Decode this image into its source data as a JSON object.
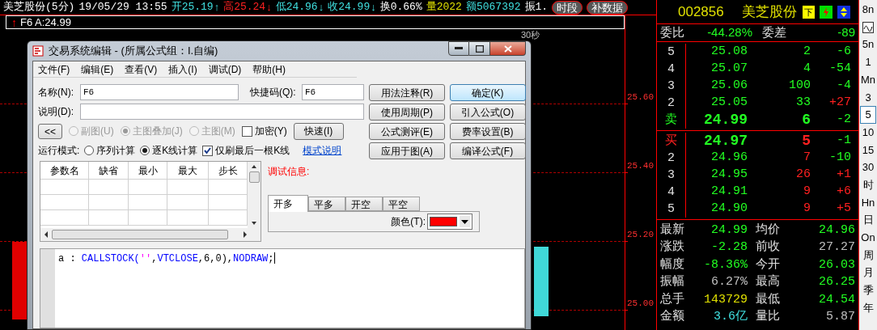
{
  "quote_bar": {
    "items": [
      {
        "text": "美芝股份(5分)",
        "color": "#ffffff"
      },
      {
        "text": "19/05/29 13:55",
        "color": "#ffffff"
      },
      {
        "text": "开25.19",
        "color": "#40e0e0",
        "arrow": "↑"
      },
      {
        "text": "高25.24",
        "color": "#ff2020",
        "arrow": "↓"
      },
      {
        "text": "低24.96",
        "color": "#40e0e0",
        "arrow": "↓"
      },
      {
        "text": "收24.99",
        "color": "#40e0e0",
        "arrow": "↓"
      },
      {
        "text": "换0.66%",
        "color": "#ffffff"
      },
      {
        "text": "量2022",
        "color": "#e0e000"
      },
      {
        "text": "额5067392",
        "color": "#40e0e0"
      },
      {
        "text": "振1.",
        "color": "#ffffff"
      }
    ],
    "badges": [
      "时段",
      "补数据"
    ]
  },
  "formula_line": {
    "arrow": "↑",
    "text": "F6 A:24.99"
  },
  "chart": {
    "time_label": "30秒",
    "price_labels": [
      "25.60",
      "25.40",
      "25.20",
      "25.00"
    ]
  },
  "dialog": {
    "title": "交易系统编辑 - (所属公式组：I.自编)",
    "menu": [
      "文件(F)",
      "编辑(E)",
      "查看(V)",
      "插入(I)",
      "调试(D)",
      "帮助(H)"
    ],
    "name_field": {
      "label": "名称(N):",
      "value": "F6"
    },
    "hotkey_field": {
      "label": "快捷码(Q):",
      "value": "F6"
    },
    "description_field": {
      "label": "说明(D):"
    },
    "buttons": [
      {
        "label": "用法注释(R)",
        "default": false
      },
      {
        "label": "确定(K)",
        "default": true
      },
      {
        "label": "使用周期(P)",
        "default": false
      },
      {
        "label": "引入公式(O)",
        "default": false
      },
      {
        "label": "公式测评(E)",
        "default": false
      },
      {
        "label": "费率设置(B)",
        "default": false
      },
      {
        "label": "应用于图(A)",
        "default": false
      },
      {
        "label": "编译公式(F)",
        "default": false
      }
    ],
    "collapse_button": "<<",
    "chart_options": [
      {
        "label": "副图(U)",
        "selected": false,
        "disabled": true
      },
      {
        "label": "主图叠加(J)",
        "selected": true,
        "disabled": true
      },
      {
        "label": "主图(M)",
        "selected": false,
        "disabled": true
      }
    ],
    "encrypt": {
      "label": "加密(Y)",
      "checked": false
    },
    "fast_button": "快速(I)",
    "run_mode": {
      "label": "运行模式:",
      "options": [
        {
          "label": "序列计算",
          "selected": false
        },
        {
          "label": "逐K线计算",
          "selected": true
        }
      ],
      "last_bar_only": {
        "label": "仅刷最后一根K线",
        "checked": true
      },
      "help_link": "模式说明"
    },
    "param_columns": [
      "参数名",
      "缺省",
      "最小",
      "最大",
      "步长"
    ],
    "debug_label": "调试信息:",
    "signal_tabs": [
      {
        "label": "开多",
        "selected": true
      },
      {
        "label": "平多",
        "selected": false
      },
      {
        "label": "开空",
        "selected": false
      },
      {
        "label": "平空",
        "selected": false
      }
    ],
    "color_picker": {
      "label": "颜色(T):",
      "color": "#ff0000"
    },
    "code": [
      {
        "text": "a : ",
        "kind": "plain"
      },
      {
        "text": "CALLSTOCK(",
        "kind": "keyword"
      },
      {
        "text": "''",
        "kind": "string"
      },
      {
        "text": ",",
        "kind": "plain"
      },
      {
        "text": "VTCLOSE",
        "kind": "keyword"
      },
      {
        "text": ",6,0),",
        "kind": "plain"
      },
      {
        "text": "NODRAW",
        "kind": "keyword"
      },
      {
        "text": ";",
        "kind": "plain"
      }
    ]
  },
  "quote_panel": {
    "code": "002856",
    "name": "美芝股份",
    "sell_flag": "下",
    "ratio": {
      "label": "委比",
      "value": "-44.28%",
      "diff_label": "委差",
      "diff": "-89"
    },
    "asks": [
      {
        "level": "5",
        "price": "25.08",
        "volume": {
          "text": "2",
          "color": "#22ff22"
        },
        "change": {
          "text": "-6",
          "color": "#22ff22"
        },
        "best": false
      },
      {
        "level": "4",
        "price": "25.07",
        "volume": {
          "text": "4",
          "color": "#22ff22"
        },
        "change": {
          "text": "-54",
          "color": "#22ff22"
        },
        "best": false
      },
      {
        "level": "3",
        "price": "25.06",
        "volume": {
          "text": "100",
          "color": "#22ff22"
        },
        "change": {
          "text": "-4",
          "color": "#22ff22"
        },
        "best": false
      },
      {
        "level": "2",
        "price": "25.05",
        "volume": {
          "text": "33",
          "color": "#22ff22"
        },
        "change": {
          "text": "+27",
          "color": "#ff2020"
        },
        "best": false
      },
      {
        "level": "卖",
        "price": "24.99",
        "volume": {
          "text": "6",
          "color": "#22ff22"
        },
        "change": {
          "text": "-2",
          "color": "#22ff22"
        },
        "best": true
      }
    ],
    "bids": [
      {
        "level": "买",
        "price": "24.97",
        "volume": {
          "text": "5",
          "color": "#ff2020"
        },
        "change": {
          "text": "-1",
          "color": "#22ff22"
        },
        "best": true
      },
      {
        "level": "2",
        "price": "24.96",
        "volume": {
          "text": "7",
          "color": "#ff2020"
        },
        "change": {
          "text": "-10",
          "color": "#22ff22"
        },
        "best": false
      },
      {
        "level": "3",
        "price": "24.95",
        "volume": {
          "text": "26",
          "color": "#ff2020"
        },
        "change": {
          "text": "+1",
          "color": "#ff2020"
        },
        "best": false
      },
      {
        "level": "4",
        "price": "24.91",
        "volume": {
          "text": "9",
          "color": "#ff2020"
        },
        "change": {
          "text": "+6",
          "color": "#ff2020"
        },
        "best": false
      },
      {
        "level": "5",
        "price": "24.90",
        "volume": {
          "text": "9",
          "color": "#ff2020"
        },
        "change": {
          "text": "+5",
          "color": "#ff2020"
        },
        "best": false
      }
    ],
    "stats": [
      [
        {
          "label": "最新",
          "value": "24.99",
          "color": "#22ff22"
        },
        {
          "label": "均价",
          "value": "24.96",
          "color": "#22ff22"
        }
      ],
      [
        {
          "label": "涨跌",
          "value": "-2.28",
          "color": "#22ff22"
        },
        {
          "label": "前收",
          "value": "27.27",
          "color": "#c0c0c0"
        }
      ],
      [
        {
          "label": "幅度",
          "value": "-8.36%",
          "color": "#22ff22"
        },
        {
          "label": "今开",
          "value": "26.03",
          "color": "#22ff22"
        }
      ],
      [
        {
          "label": "振幅",
          "value": "6.27%",
          "color": "#c0c0c0"
        },
        {
          "label": "最高",
          "value": "26.25",
          "color": "#22ff22"
        }
      ],
      [
        {
          "label": "总手",
          "value": "143729",
          "color": "#e0e000"
        },
        {
          "label": "最低",
          "value": "24.54",
          "color": "#22ff22"
        }
      ],
      [
        {
          "label": "金额",
          "value": "3.6亿",
          "color": "#40e0e0"
        },
        {
          "label": "量比",
          "value": "5.87",
          "color": "#c0c0c0"
        }
      ]
    ]
  },
  "periods": [
    {
      "kind": "text",
      "label": "8n",
      "selected": false
    },
    {
      "kind": "icon",
      "selected": false
    },
    {
      "kind": "text",
      "label": "5n",
      "selected": false
    },
    {
      "kind": "text",
      "label": "1",
      "selected": false
    },
    {
      "kind": "text",
      "label": "Mn",
      "selected": false
    },
    {
      "kind": "text",
      "label": "3",
      "selected": false
    },
    {
      "kind": "text",
      "label": "5",
      "selected": true
    },
    {
      "kind": "text",
      "label": "10",
      "selected": false
    },
    {
      "kind": "text",
      "label": "15",
      "selected": false
    },
    {
      "kind": "text",
      "label": "30",
      "selected": false
    },
    {
      "kind": "text",
      "label": "时",
      "selected": false
    },
    {
      "kind": "text",
      "label": "Hn",
      "selected": false
    },
    {
      "kind": "text",
      "label": "日",
      "selected": false
    },
    {
      "kind": "text",
      "label": "On",
      "selected": false
    },
    {
      "kind": "text",
      "label": "周",
      "selected": false
    },
    {
      "kind": "text",
      "label": "月",
      "selected": false
    },
    {
      "kind": "text",
      "label": "季",
      "selected": false
    },
    {
      "kind": "text",
      "label": "年",
      "selected": false
    }
  ]
}
